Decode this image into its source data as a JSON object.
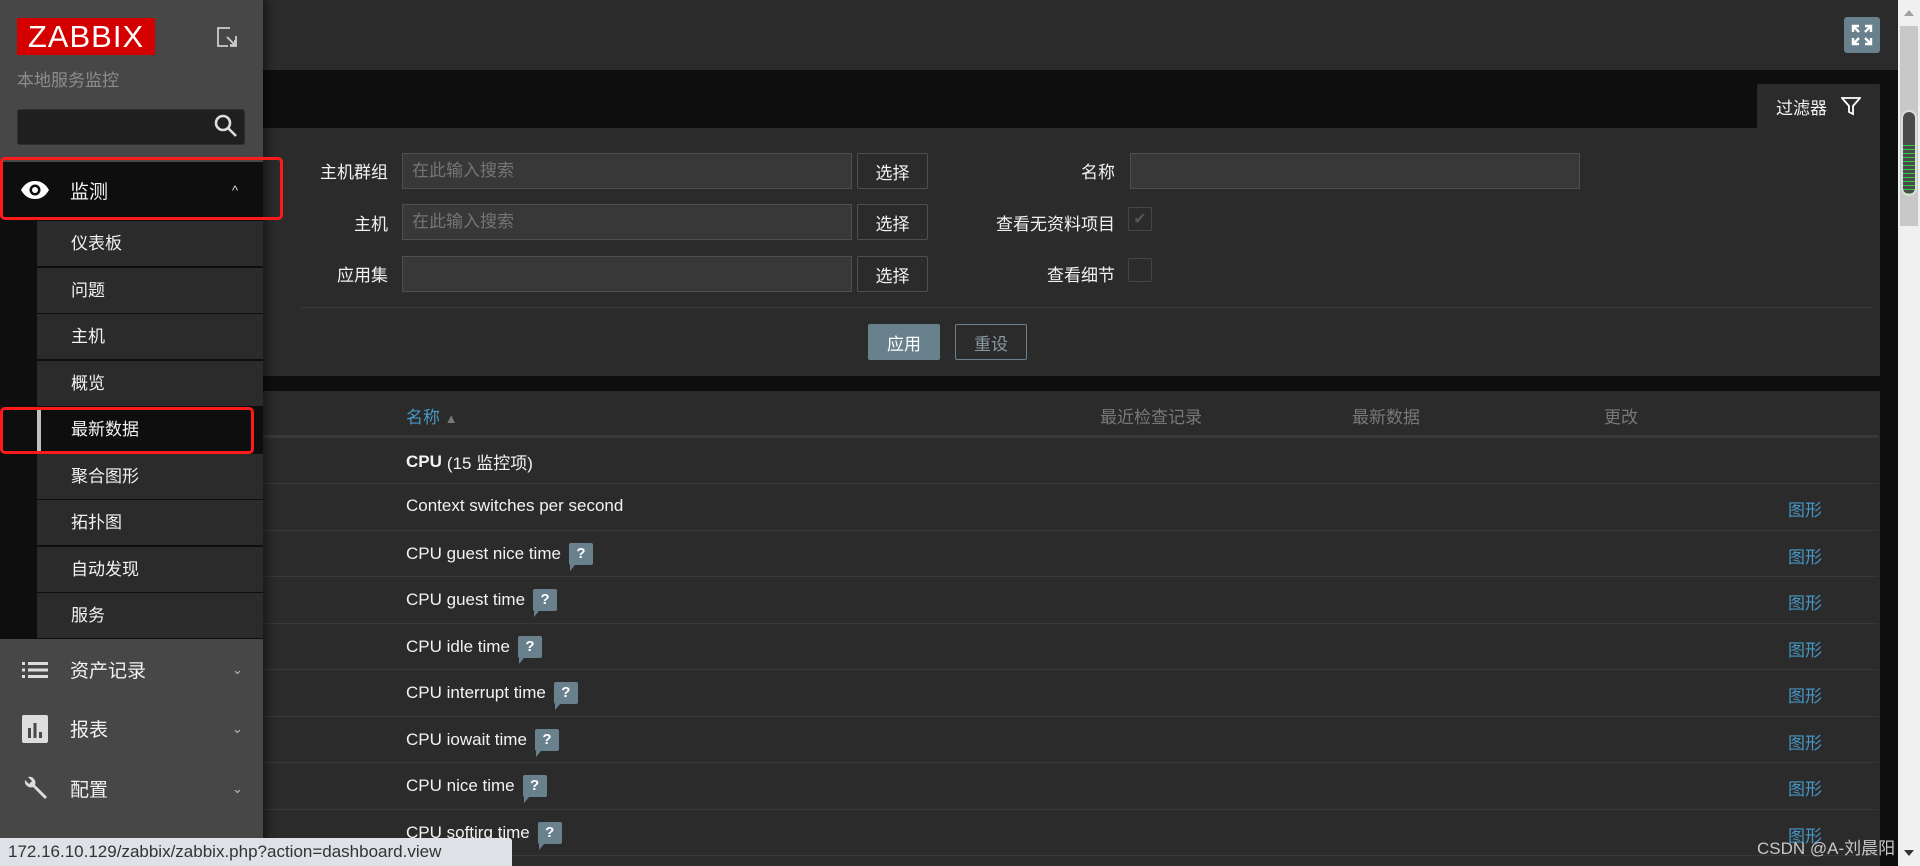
{
  "sidebar": {
    "logo": "ZABBIX",
    "subtitle": "本地服务监控",
    "search_value": "",
    "monitoring": {
      "label": "监测",
      "icon": "eye-icon",
      "expanded": true
    },
    "submenu": [
      {
        "label": "仪表板"
      },
      {
        "label": "问题"
      },
      {
        "label": "主机"
      },
      {
        "label": "概览"
      },
      {
        "label": "最新数据",
        "active": true
      },
      {
        "label": "聚合图形"
      },
      {
        "label": "拓扑图"
      },
      {
        "label": "自动发现"
      },
      {
        "label": "服务"
      }
    ],
    "sections": [
      {
        "label": "资产记录",
        "icon": "list-icon"
      },
      {
        "label": "报表",
        "icon": "bar-chart-icon"
      },
      {
        "label": "配置",
        "icon": "wrench-icon"
      }
    ]
  },
  "filter": {
    "tab_label": "过滤器",
    "host_group_label": "主机群组",
    "host_group_placeholder": "在此输入搜索",
    "host_label": "主机",
    "host_placeholder": "在此输入搜索",
    "application_label": "应用集",
    "application_value": "",
    "select_label": "选择",
    "name_label": "名称",
    "name_value": "",
    "show_without_data_label": "查看无资料项目",
    "show_without_data_checked": true,
    "show_details_label": "查看细节",
    "show_details_checked": false,
    "apply_label": "应用",
    "reset_label": "重设"
  },
  "table": {
    "columns": {
      "name": "名称",
      "sort_indicator": "▲",
      "last_check": "最近检查记录",
      "last_value": "最新数据",
      "change": "更改"
    },
    "group": {
      "name": "CPU",
      "count": "(15 监控项)"
    },
    "graph_label": "图形",
    "rows": [
      {
        "name": "Context switches per second",
        "help": false
      },
      {
        "name": "CPU guest nice time",
        "help": true
      },
      {
        "name": "CPU guest time",
        "help": true
      },
      {
        "name": "CPU idle time",
        "help": true
      },
      {
        "name": "CPU interrupt time",
        "help": true
      },
      {
        "name": "CPU iowait time",
        "help": true
      },
      {
        "name": "CPU nice time",
        "help": true
      },
      {
        "name": "CPU softirq time",
        "help": true
      }
    ]
  },
  "statusbar": {
    "url": "172.16.10.129/zabbix/zabbix.php?action=dashboard.view"
  },
  "watermark": "CSDN @A-刘晨阳",
  "colors": {
    "brand": "#d40000",
    "accent": "#69808d",
    "link": "#4796c4",
    "annotation": "#ff1a1a"
  }
}
